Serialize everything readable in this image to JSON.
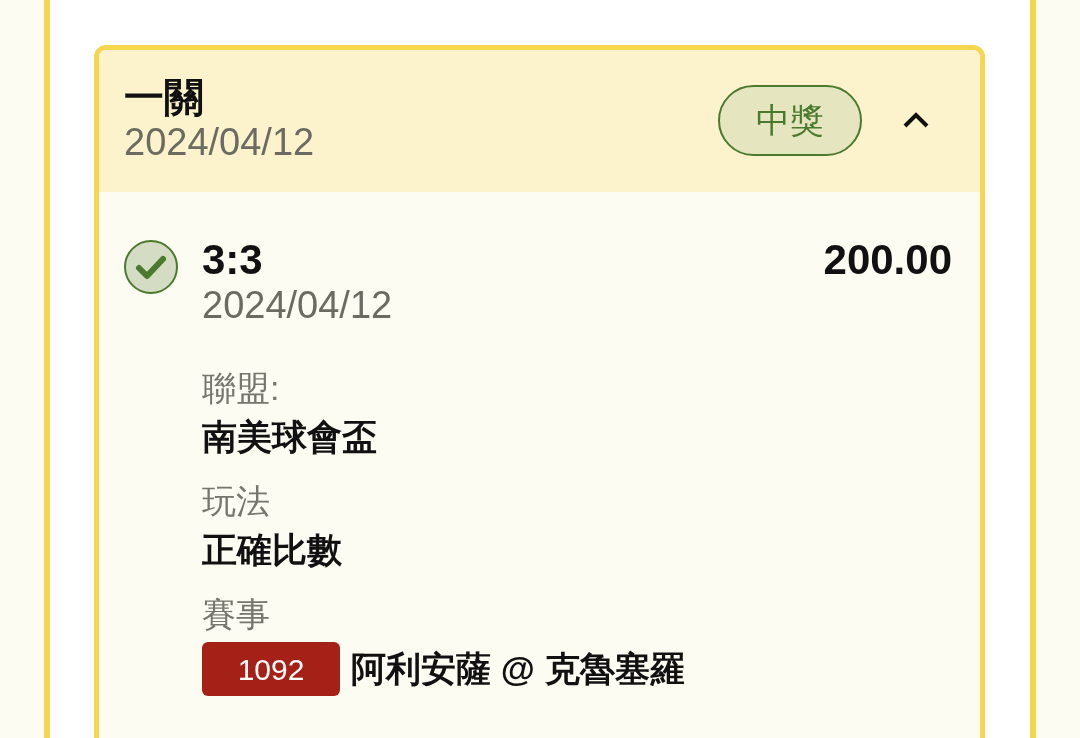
{
  "bet": {
    "title": "一關",
    "date": "2024/04/12",
    "status": {
      "label": "中獎",
      "kind": "won"
    },
    "expanded": true,
    "selections": [
      {
        "won": true,
        "score": "3:3",
        "date": "2024/04/12",
        "amount": "200.00",
        "fields": [
          {
            "label": "聯盟:",
            "value": "南美球會盃"
          },
          {
            "label": "玩法",
            "value": "正確比數"
          }
        ],
        "event": {
          "label": "賽事",
          "code": "1092",
          "match": "阿利安薩 @ 克魯塞羅"
        }
      }
    ]
  }
}
